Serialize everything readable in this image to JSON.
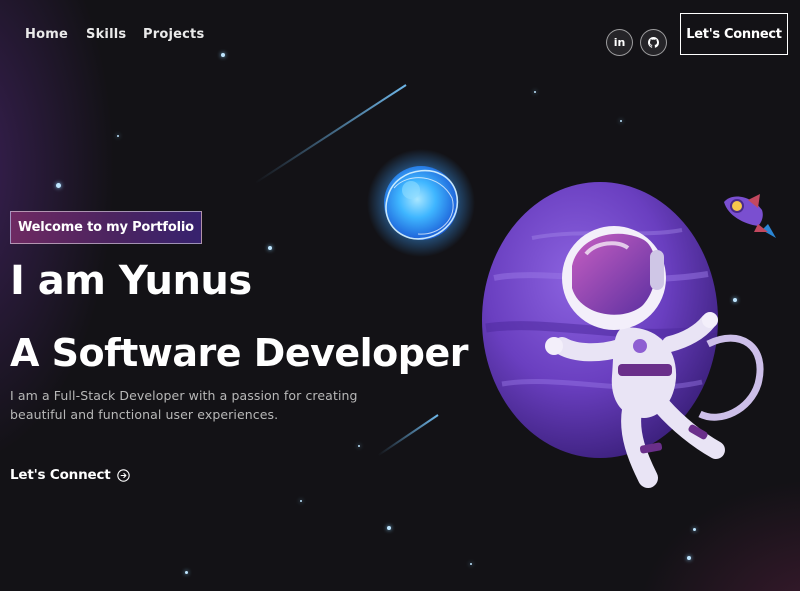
{
  "nav": {
    "links": [
      {
        "label": "Home"
      },
      {
        "label": "Skills"
      },
      {
        "label": "Projects"
      }
    ],
    "social": [
      {
        "icon": "linkedin-icon",
        "glyph": "in"
      },
      {
        "icon": "github-icon",
        "glyph": "◔"
      }
    ],
    "connect_label": "Let's Connect"
  },
  "hero": {
    "tagline": "Welcome to my Portfolio",
    "title_line1": "I am Yunus",
    "title_line2": "A Software Developer",
    "description": "I am a Full-Stack Developer with a passion for creating beautiful and functional user experiences.",
    "cta_label": "Let's Connect",
    "cta_icon": "arrow-right-circle-icon"
  },
  "colors": {
    "background": "#131216",
    "accent_pink": "#aa367c",
    "accent_violet": "#4a2fbd",
    "planet_purple": "#6a3fc0",
    "star_blue": "#8fd3ff"
  }
}
